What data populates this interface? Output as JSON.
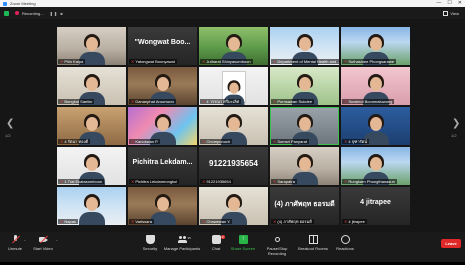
{
  "window": {
    "title": "Zoom Meeting",
    "controls": [
      "—",
      "☐",
      "✕"
    ]
  },
  "header": {
    "recording_text": "Recording...",
    "recording_controls": "❚❚ ■",
    "view_label": "View"
  },
  "gallery": {
    "page_left": "1/2",
    "page_right": "1/2",
    "tiles": [
      {
        "name": "Pilin Kaipa",
        "big": "",
        "bg": "room",
        "kind": "person"
      },
      {
        "name": "Yatongwat Boonyawat",
        "big": "\"Wongwat Boo...",
        "bg": "dark",
        "kind": "text"
      },
      {
        "name": "Jutharat Shinyasomboon",
        "big": "",
        "bg": "garden",
        "kind": "person"
      },
      {
        "name": "Department of Mental Health and ...",
        "big": "",
        "bg": "sky",
        "kind": "person"
      },
      {
        "name": "Suthasinee Phongsarawe",
        "big": "",
        "bg": "campus",
        "kind": "person"
      },
      {
        "name": "Bongkot Saelim",
        "big": "",
        "bg": "office",
        "kind": "person"
      },
      {
        "name": "Dananphat Aroonwon",
        "big": "",
        "bg": "shelf",
        "kind": "person"
      },
      {
        "name": "4 วรรณา ศรีมะเลิศ",
        "big": "",
        "bg": "white",
        "kind": "doc"
      },
      {
        "name": "Pornsawan Sukdee",
        "big": "",
        "bg": "green2",
        "kind": "person"
      },
      {
        "name": "Suwimol Boonmatuwong",
        "big": "",
        "bg": "pink",
        "kind": "person"
      },
      {
        "name": "4 รัตนา ทองดี",
        "big": "",
        "bg": "wood",
        "kind": "person"
      },
      {
        "name": "Kanokwan P.",
        "big": "",
        "bg": "art",
        "kind": "person"
      },
      {
        "name": "Chompunuch",
        "big": "",
        "bg": "office",
        "kind": "person"
      },
      {
        "name": "Somsri Panyarat",
        "big": "",
        "bg": "gray",
        "kind": "person"
      },
      {
        "name": "4 จุฑารัตน์",
        "big": "",
        "bg": "blue",
        "kind": "person"
      },
      {
        "name": "1 Trai Ekatasomboon",
        "big": "",
        "bg": "white",
        "kind": "person"
      },
      {
        "name": "Pichitra Lekdamrongkul",
        "big": "Pichitra  Lekdam...",
        "bg": "dark",
        "kind": "text"
      },
      {
        "name": "91221935654",
        "big": "91221935654",
        "bg": "dark",
        "kind": "text"
      },
      {
        "name": "Sarapatra",
        "big": "",
        "bg": "room",
        "kind": "person"
      },
      {
        "name": "Rungkarn Phongthanasun",
        "big": "",
        "bg": "campus",
        "kind": "person"
      },
      {
        "name": "Napas",
        "big": "",
        "bg": "sky",
        "kind": "person"
      },
      {
        "name": "Varissara",
        "big": "",
        "bg": "shelf",
        "kind": "person"
      },
      {
        "name": "Chawewan Y.",
        "big": "",
        "bg": "office",
        "kind": "person"
      },
      {
        "name": "(4) ภาศัพฤท ธอรมดี",
        "big": "(4)  ภาศัพฤท ธอรมดี",
        "bg": "dark",
        "kind": "text"
      },
      {
        "name": "4 jitrapee",
        "big": "4 jitrapee",
        "bg": "dark",
        "kind": "text"
      }
    ]
  },
  "toolbar": {
    "unmute": "Unmute",
    "start_video": "Start Video",
    "security": "Security",
    "participants": "Manage Participants",
    "participants_count": "35",
    "chat": "Chat",
    "chat_badge": "2",
    "share": "Share Screen",
    "recording": "Pause/Stop Recording",
    "breakout": "Breakout Rooms",
    "reactions": "Reactions",
    "leave": "Leave"
  }
}
